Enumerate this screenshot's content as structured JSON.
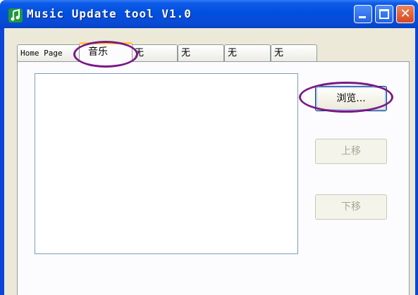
{
  "window": {
    "title": "Music Update tool V1.0",
    "icon": "music-note-icon",
    "controls": {
      "minimize": "minimize-icon",
      "maximize": "maximize-icon",
      "close": "close-icon",
      "close_glyph": "✕"
    }
  },
  "tabs": [
    {
      "label": "Home Page",
      "active": false
    },
    {
      "label": "音乐",
      "active": true
    },
    {
      "label": "无",
      "active": false
    },
    {
      "label": "无",
      "active": false
    },
    {
      "label": "无",
      "active": false
    },
    {
      "label": "无",
      "active": false
    }
  ],
  "panel": {
    "buttons": {
      "browse": "浏览...",
      "move_up": "上移",
      "move_down": "下移"
    },
    "button_states": {
      "browse": "enabled",
      "move_up": "disabled",
      "move_down": "disabled"
    }
  },
  "colors": {
    "titlebar": "#0a46d8",
    "annotation": "#7a1a86",
    "tab_highlight": "#ffc83c"
  }
}
